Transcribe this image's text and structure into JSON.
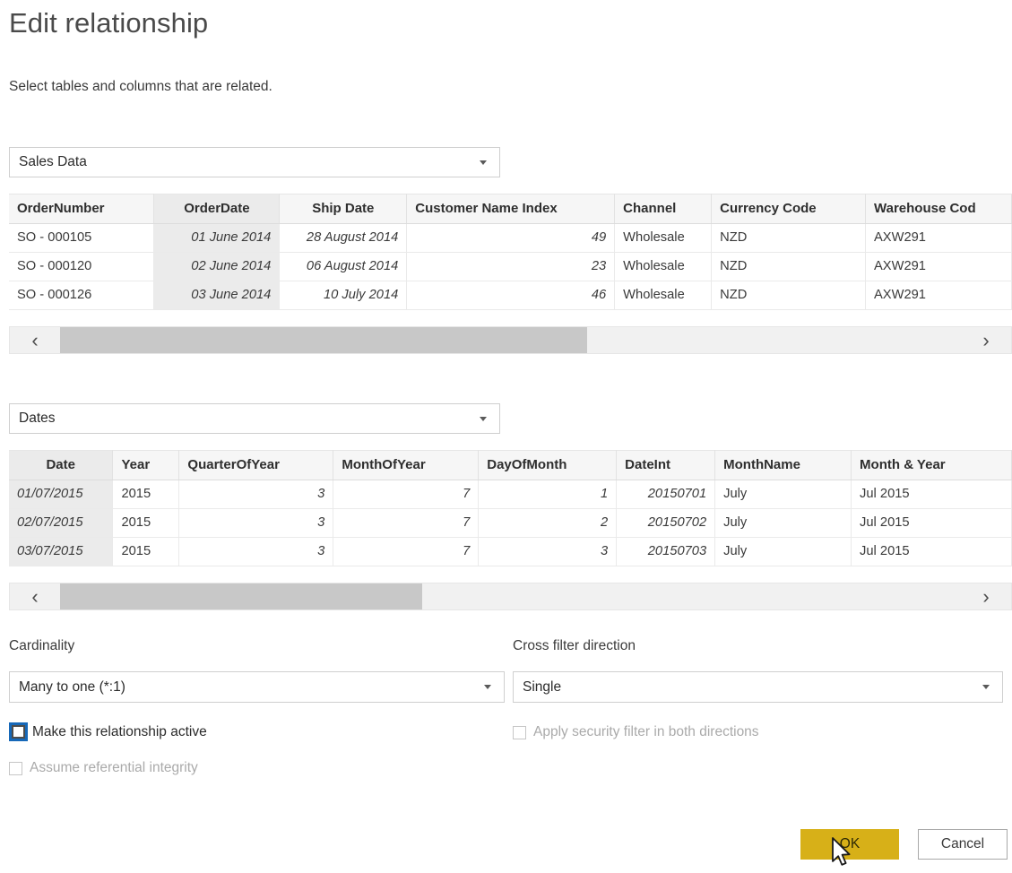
{
  "dialog": {
    "title": "Edit relationship",
    "subtitle": "Select tables and columns that are related."
  },
  "table1": {
    "selected_table": "Sales Data",
    "selected_column": "OrderDate",
    "columns": [
      "OrderNumber",
      "OrderDate",
      "Ship Date",
      "Customer Name Index",
      "Channel",
      "Currency Code",
      "Warehouse Cod"
    ],
    "rows": [
      [
        "SO - 000105",
        "01 June 2014",
        "28 August 2014",
        "49",
        "Wholesale",
        "NZD",
        "AXW291"
      ],
      [
        "SO - 000120",
        "02 June 2014",
        "06 August 2014",
        "23",
        "Wholesale",
        "NZD",
        "AXW291"
      ],
      [
        "SO - 000126",
        "03 June 2014",
        "10 July 2014",
        "46",
        "Wholesale",
        "NZD",
        "AXW291"
      ]
    ],
    "scroll_left_icon": "‹",
    "scroll_right_icon": "›"
  },
  "table2": {
    "selected_table": "Dates",
    "selected_column": "Date",
    "columns": [
      "Date",
      "Year",
      "QuarterOfYear",
      "MonthOfYear",
      "DayOfMonth",
      "DateInt",
      "MonthName",
      "Month & Year"
    ],
    "rows": [
      [
        "01/07/2015",
        "2015",
        "3",
        "7",
        "1",
        "20150701",
        "July",
        "Jul 2015"
      ],
      [
        "02/07/2015",
        "2015",
        "3",
        "7",
        "2",
        "20150702",
        "July",
        "Jul 2015"
      ],
      [
        "03/07/2015",
        "2015",
        "3",
        "7",
        "3",
        "20150703",
        "July",
        "Jul 2015"
      ]
    ],
    "scroll_left_icon": "‹",
    "scroll_right_icon": "›"
  },
  "options": {
    "cardinality_label": "Cardinality",
    "cardinality_value": "Many to one (*:1)",
    "crossfilter_label": "Cross filter direction",
    "crossfilter_value": "Single",
    "make_active_label": "Make this relationship active",
    "security_filter_label": "Apply security filter in both directions",
    "referential_integrity_label": "Assume referential integrity"
  },
  "footer": {
    "ok_label": "OK",
    "cancel_label": "Cancel"
  },
  "colors": {
    "ok_button": "#d7b018",
    "focus_ring": "#1668b8",
    "header_bg": "#f6f6f6",
    "selected_column_bg": "#ebebeb",
    "scrollbar_thumb": "#c8c8c8"
  }
}
